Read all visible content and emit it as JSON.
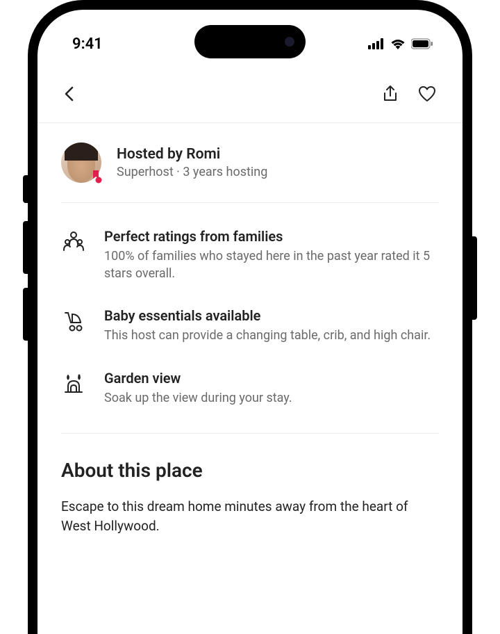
{
  "statusBar": {
    "time": "9:41"
  },
  "host": {
    "title": "Hosted by Romi",
    "subtitle": "Superhost · 3 years hosting"
  },
  "features": [
    {
      "icon": "family-icon",
      "title": "Perfect ratings from families",
      "desc": "100% of families who stayed here in the past year rated it 5 stars overall."
    },
    {
      "icon": "stroller-icon",
      "title": "Baby essentials available",
      "desc": "This host can provide a changing table, crib, and high chair."
    },
    {
      "icon": "garden-icon",
      "title": "Garden view",
      "desc": "Soak up the view during your stay."
    }
  ],
  "about": {
    "heading": "About this place",
    "body": "Escape to this dream home minutes away from the heart of West Hollywood."
  }
}
